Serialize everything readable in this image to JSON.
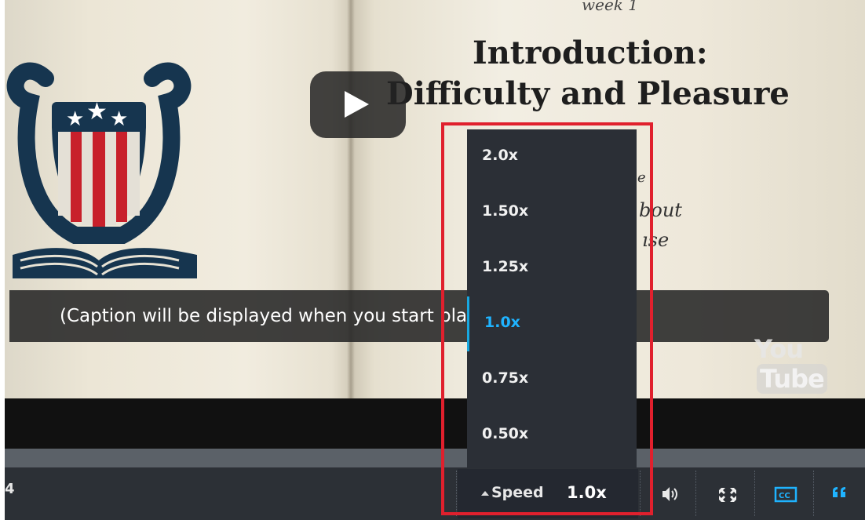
{
  "video": {
    "week_label": "week 1",
    "title_line1": "Introduction:",
    "title_line2": "Difficulty and Pleasure",
    "subtitle_line1": "e",
    "subtitle_line2": "bout",
    "subtitle_line3": "ıse",
    "caption": "(Caption will be displayed when you start playing the video.)",
    "youtube_watermark_1": "You",
    "youtube_watermark_2": "Tube"
  },
  "controls": {
    "time_partial": "4",
    "speed_label": "Speed",
    "speed_value": "1.0x",
    "icons": [
      "volume-icon",
      "fullscreen-icon",
      "closed-captions-icon",
      "transcript-quote-icon"
    ],
    "accent_color": "#1fb3ff"
  },
  "speed_menu": {
    "options": [
      "2.0x",
      "1.50x",
      "1.25x",
      "1.0x",
      "0.75x",
      "0.50x"
    ],
    "selected": "1.0x"
  },
  "highlight_color": "#e0202d"
}
